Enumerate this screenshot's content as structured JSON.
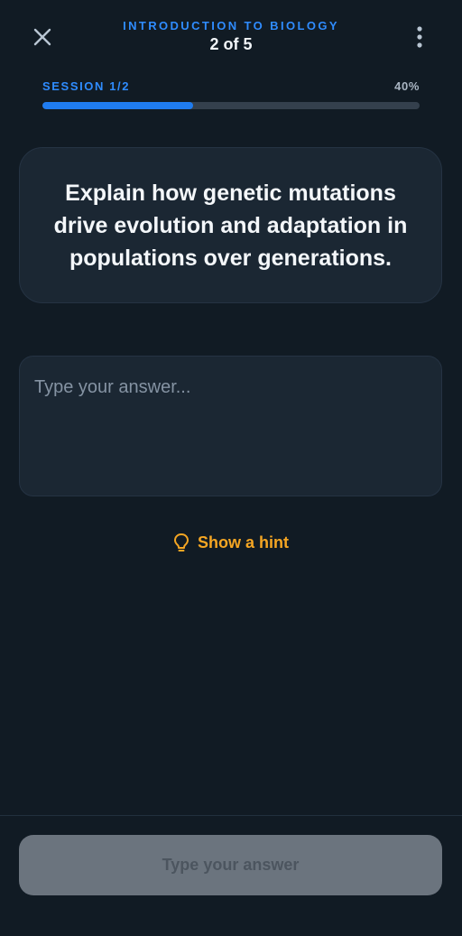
{
  "header": {
    "course_title": "INTRODUCTION TO BIOLOGY",
    "step_counter": "2 of 5",
    "close_icon": "close-icon",
    "menu_icon": "more-vertical-icon"
  },
  "session": {
    "label": "SESSION 1/2",
    "progress_label": "40%",
    "progress_fraction": 0.4
  },
  "question": {
    "text": "Explain how genetic mutations drive evolution and adaptation in populations over generations."
  },
  "answer": {
    "value": "",
    "placeholder": "Type your answer..."
  },
  "hint": {
    "label": "Show a hint",
    "icon": "lightbulb-icon"
  },
  "footer": {
    "submit_label": "Type your answer"
  },
  "colors": {
    "background": "#111b24",
    "accent": "#2f8cff",
    "hint": "#f5a623",
    "disabled_button": "#6b747e"
  }
}
